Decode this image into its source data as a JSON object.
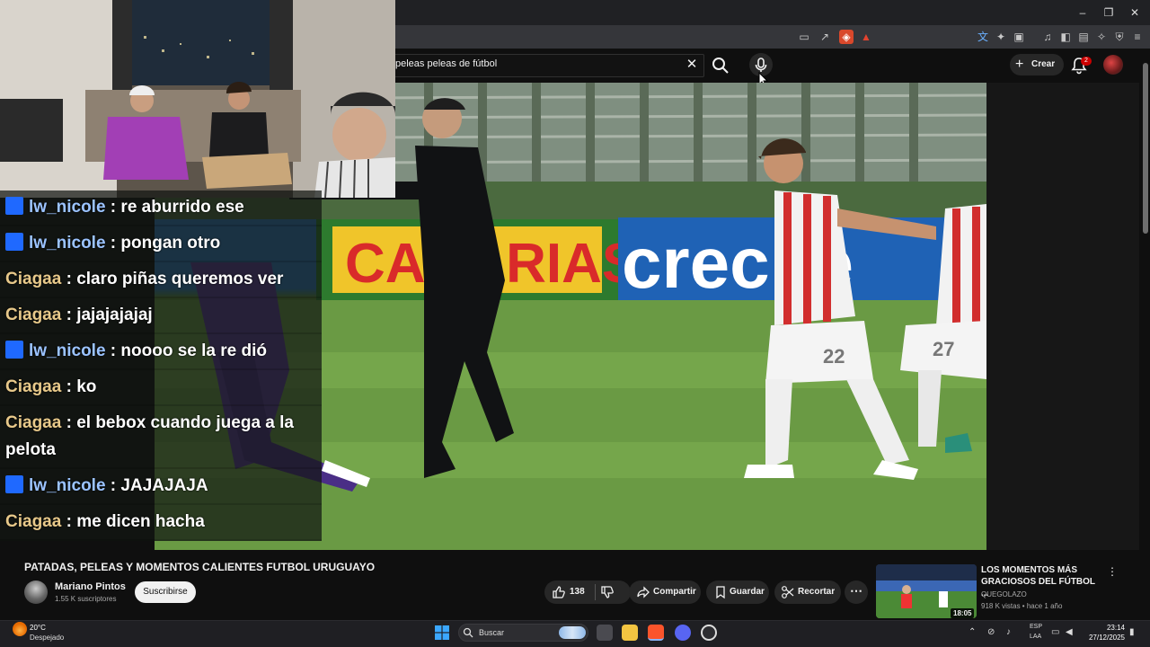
{
  "browser": {
    "window_controls": [
      "–",
      "❐",
      "✕"
    ]
  },
  "youtube_header": {
    "search_value": "peleas peleas de fútbol",
    "create_label": "Crear",
    "notification_count": "2"
  },
  "chat": {
    "messages": [
      {
        "user": "lw_nicole",
        "text": "re aburrido ese",
        "badge": true,
        "color": "#9bc3ff"
      },
      {
        "user": "lw_nicole",
        "text": "pongan otro",
        "badge": true,
        "color": "#9bc3ff"
      },
      {
        "user": "Ciagaa",
        "text": "claro piñas queremos ver",
        "badge": false,
        "color": "#e8c98a"
      },
      {
        "user": "Ciagaa",
        "text": "jajajajajaj",
        "badge": false,
        "color": "#e8c98a"
      },
      {
        "user": "lw_nicole",
        "text": "noooo se la re dió",
        "badge": true,
        "color": "#9bc3ff"
      },
      {
        "user": "Ciagaa",
        "text": "ko",
        "badge": false,
        "color": "#e8c98a"
      },
      {
        "user": "Ciagaa",
        "text": "el bebox cuando juega a la pelota",
        "badge": false,
        "color": "#e8c98a"
      },
      {
        "user": "lw_nicole",
        "text": "JAJAJAJA",
        "badge": true,
        "color": "#9bc3ff"
      },
      {
        "user": "Ciagaa",
        "text": "me dicen hacha",
        "badge": false,
        "color": "#e8c98a"
      }
    ]
  },
  "video_scene": {
    "board_left": "CANARIAS",
    "board_right": "crecite",
    "jersey_1": "22",
    "jersey_2": "27"
  },
  "video_info": {
    "title": "PATADAS, PELEAS Y MOMENTOS CALIENTES FUTBOL URUGUAYO",
    "channel": "Mariano Pintos",
    "subscribers": "1.55 K suscriptores",
    "subscribe_label": "Suscribirse",
    "likes": "138",
    "share_label": "Compartir",
    "save_label": "Guardar",
    "clip_label": "Recortar"
  },
  "recommended": {
    "title": "LOS MOMENTOS MÁS GRACIOSOS DEL FÚTBOL ...",
    "channel": "QUEGOLAZO",
    "meta": "918 K vistas • hace 1 año",
    "duration": "18:05"
  },
  "taskbar": {
    "temperature": "20°C",
    "condition": "Despejado",
    "search_placeholder": "Buscar",
    "lang_top": "ESP",
    "lang_bottom": "LAA",
    "time": "23:14",
    "date": "27/12/2025"
  },
  "colors": {
    "yt_bg": "#0f0f0f",
    "accent_red": "#cc0000",
    "chat_blue": "#9bc3ff",
    "chat_tan": "#e8c98a"
  }
}
